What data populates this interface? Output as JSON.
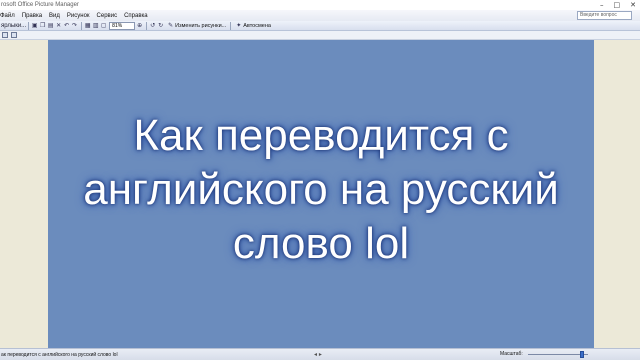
{
  "window": {
    "title": "rosoft Office Picture Manager",
    "controls": [
      "–",
      "□",
      "✕"
    ]
  },
  "menu": {
    "items": [
      "Файл",
      "Правка",
      "Вид",
      "Рисунок",
      "Сервис",
      "Справка"
    ],
    "help_placeholder": "Введите вопрос"
  },
  "toolbar": {
    "shortcuts_label": "ярлыки...",
    "zoom_value": "81%",
    "edit_picture_label": "Изменить рисунки...",
    "autocorrect_label": "Автосмена"
  },
  "slide": {
    "text": "Как переводится с английского на русский слово lol",
    "background": "#6b8cbd"
  },
  "status": {
    "filename": "ак переводится с английского на русский слово lol",
    "zoom_label": "Масштаб:"
  }
}
